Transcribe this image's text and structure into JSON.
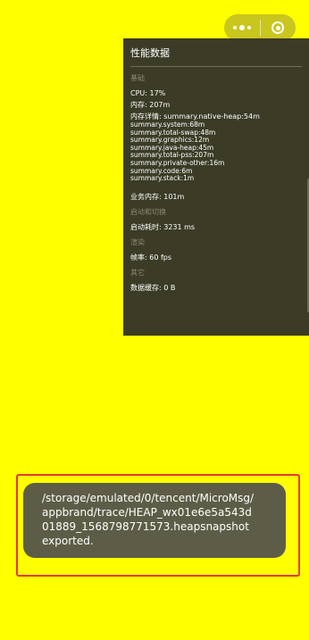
{
  "capsule": {
    "more_icon": "ellipsis-icon",
    "close_icon": "circle-target-icon"
  },
  "perf": {
    "title": "性能数据",
    "sections": {
      "basic": "基础",
      "startup": "启动和切换",
      "render": "渲染",
      "other": "其它"
    },
    "cpu": "CPU: 17%",
    "memory": "内存: 207m",
    "memory_detail_label": "内存详情: summary.native-heap:54m",
    "memory_details": [
      "summary.system:68m",
      "summary.total-swap:48m",
      "summary.graphics:12m",
      "summary.java-heap:45m",
      "summary.total-pss:207m",
      "summary.private-other:16m",
      "summary.code:6m",
      "summary.stack:1m"
    ],
    "business_memory": "业务内存: 101m",
    "startup_time": "启动耗时: 3231 ms",
    "fps": "帧率: 60 fps",
    "data_cache": "数据缓存: 0 B"
  },
  "toast": {
    "lines": [
      "/storage/emulated/0/tencent/MicroMsg/",
      "appbrand/trace/HEAP_wx01e6e5a543d",
      "01889_1568798771573.heapsnapshot",
      "exported."
    ]
  },
  "colors": {
    "background": "#ffff00",
    "panel": "#3b3b26",
    "toast": "#5d5d47",
    "highlight": "#e53935"
  }
}
